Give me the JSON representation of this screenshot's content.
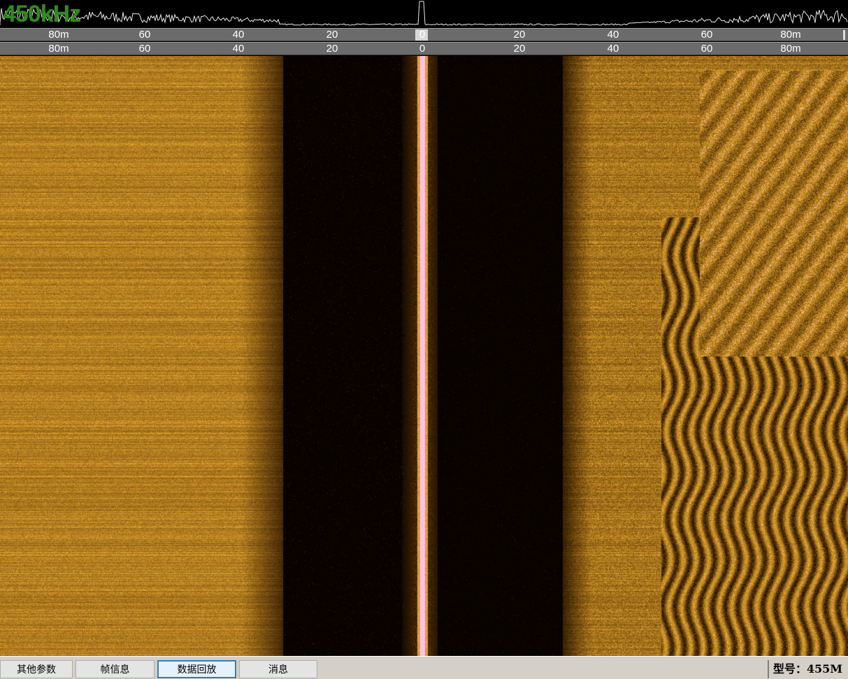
{
  "waveform": {
    "frequency_label": "450kHz"
  },
  "scale_top": {
    "ticks": [
      "80m",
      "60",
      "40",
      "20",
      "0",
      "20",
      "40",
      "60",
      "80m"
    ]
  },
  "scale_bottom": {
    "ticks": [
      "80m",
      "60",
      "40",
      "20",
      "0",
      "20",
      "40",
      "60",
      "80m"
    ]
  },
  "colors": {
    "sonar_palette": "#c8901e",
    "frequency_label": "#2e8b1e",
    "scale_background": "#6b6b6b",
    "active_tab_border": "#3c7fb1"
  },
  "statusbar": {
    "tabs": [
      {
        "label": "其他参数"
      },
      {
        "label": "帧信息"
      },
      {
        "label": "数据回放"
      },
      {
        "label": "消息"
      }
    ],
    "active_tab": "数据回放",
    "model_label": "型号：455M"
  }
}
